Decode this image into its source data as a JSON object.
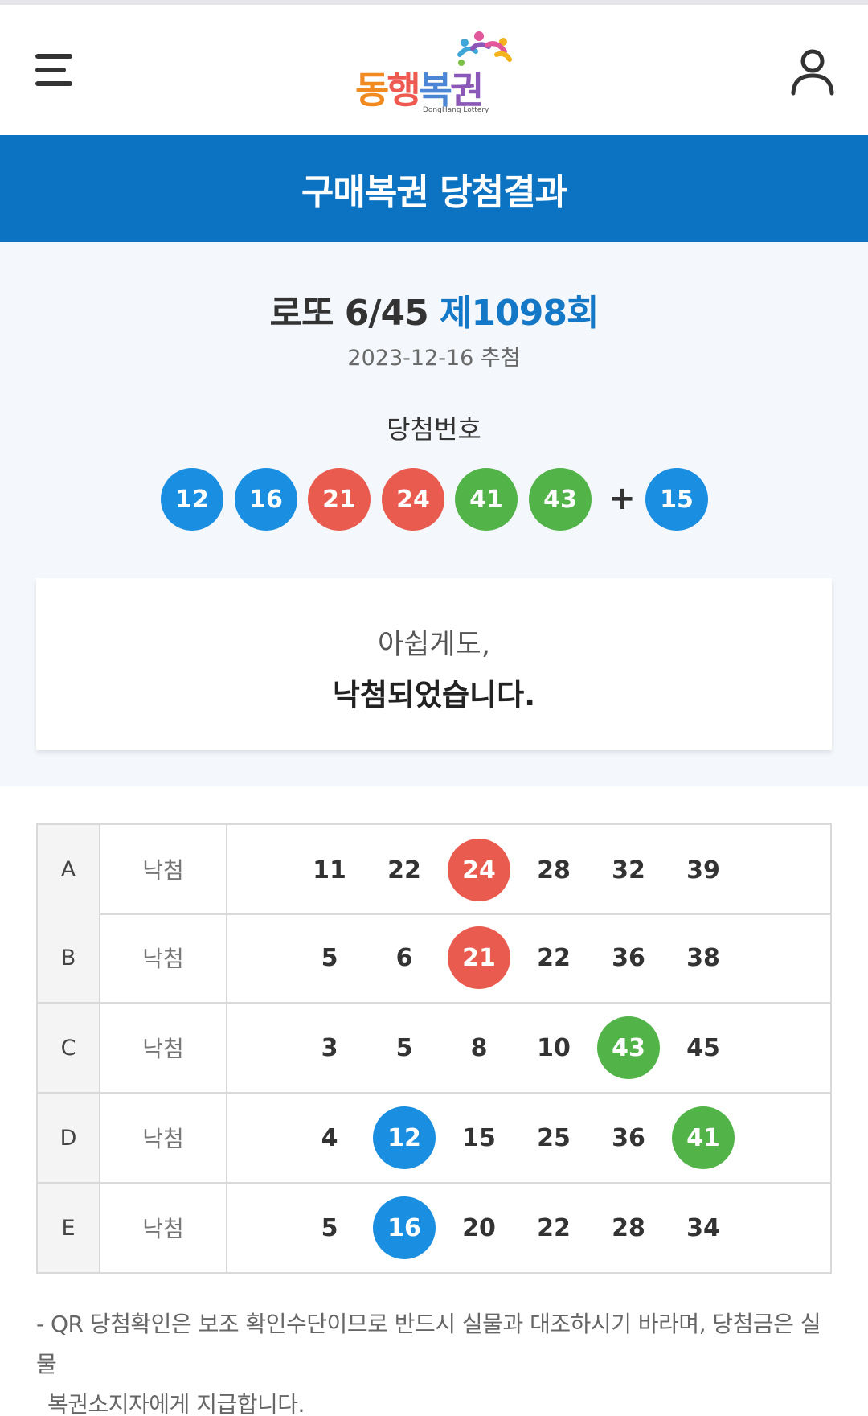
{
  "header": {
    "logo_text_parts": [
      "동",
      "행",
      "복",
      "권"
    ],
    "logo_subtitle": "DongHang Lottery",
    "menu_icon": "hamburger-menu-icon",
    "user_icon": "user-account-icon"
  },
  "banner": {
    "title": "구매복권 당첨결과"
  },
  "result": {
    "game_name": "로또 6/45",
    "round": "제1098회",
    "draw_date": "2023-12-16 추첨",
    "winning_label": "당첨번호",
    "winning_numbers": [
      {
        "value": "12",
        "color": "#1a8ee0"
      },
      {
        "value": "16",
        "color": "#1a8ee0"
      },
      {
        "value": "21",
        "color": "#e95b4e"
      },
      {
        "value": "24",
        "color": "#e95b4e"
      },
      {
        "value": "41",
        "color": "#52b348"
      },
      {
        "value": "43",
        "color": "#52b348"
      }
    ],
    "plus_sign": "+",
    "bonus_number": {
      "value": "15",
      "color": "#1a8ee0"
    },
    "message_line1": "아쉽게도,",
    "message_line2": "낙첨되었습니다."
  },
  "ticket": {
    "rows": [
      {
        "game": "A",
        "status": "낙첨",
        "numbers": [
          {
            "value": "11"
          },
          {
            "value": "22"
          },
          {
            "value": "24",
            "hit": true,
            "color": "#e95b4e"
          },
          {
            "value": "28"
          },
          {
            "value": "32"
          },
          {
            "value": "39"
          }
        ]
      },
      {
        "game": "B",
        "status": "낙첨",
        "numbers": [
          {
            "value": "5"
          },
          {
            "value": "6"
          },
          {
            "value": "21",
            "hit": true,
            "color": "#e95b4e"
          },
          {
            "value": "22"
          },
          {
            "value": "36"
          },
          {
            "value": "38"
          }
        ]
      },
      {
        "game": "C",
        "status": "낙첨",
        "numbers": [
          {
            "value": "3"
          },
          {
            "value": "5"
          },
          {
            "value": "8"
          },
          {
            "value": "10"
          },
          {
            "value": "43",
            "hit": true,
            "color": "#52b348"
          },
          {
            "value": "45"
          }
        ]
      },
      {
        "game": "D",
        "status": "낙첨",
        "numbers": [
          {
            "value": "4"
          },
          {
            "value": "12",
            "hit": true,
            "color": "#1a8ee0"
          },
          {
            "value": "15"
          },
          {
            "value": "25"
          },
          {
            "value": "36"
          },
          {
            "value": "41",
            "hit": true,
            "color": "#52b348"
          }
        ]
      },
      {
        "game": "E",
        "status": "낙첨",
        "numbers": [
          {
            "value": "5"
          },
          {
            "value": "16",
            "hit": true,
            "color": "#1a8ee0"
          },
          {
            "value": "20"
          },
          {
            "value": "22"
          },
          {
            "value": "28"
          },
          {
            "value": "34"
          }
        ]
      }
    ]
  },
  "notice": {
    "line1": "- QR 당첨확인은 보조 확인수단이므로 반드시 실물과 대조하시기 바라며, 당첨금은 실물",
    "line2": "복권소지자에게 지급합니다."
  }
}
